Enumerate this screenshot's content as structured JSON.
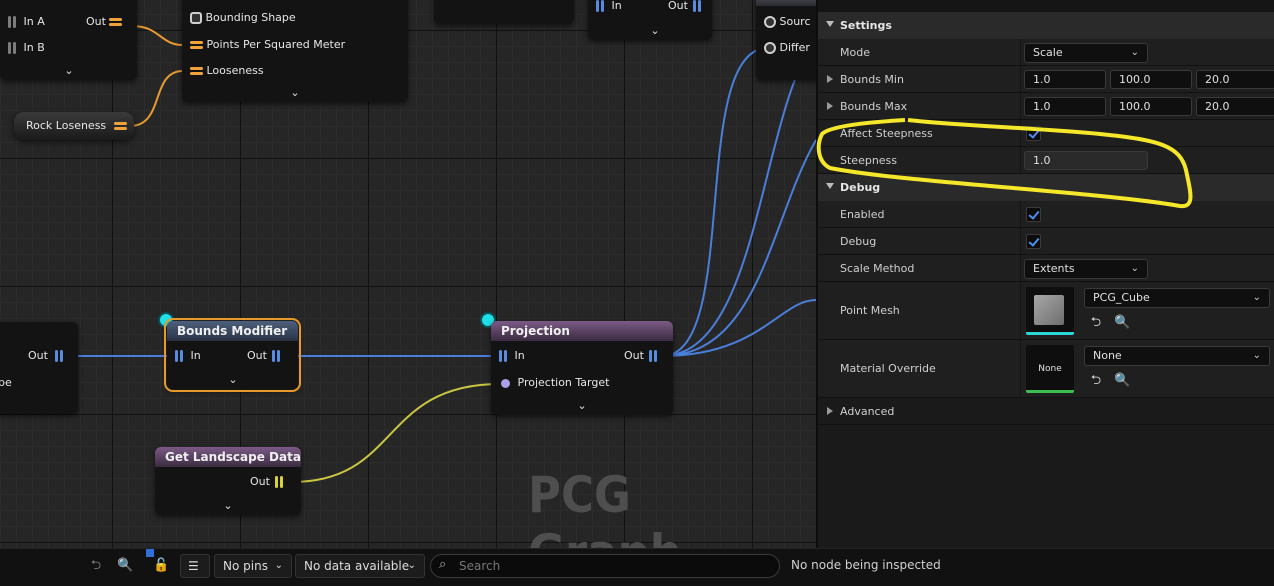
{
  "graph": {
    "watermark": "PCG Graph",
    "top_partial_node": {
      "in_a": "In A",
      "in_b": "In B",
      "out": "Out"
    },
    "surface_sampler_partial": {
      "bounding_shape": "Bounding Shape",
      "points_per_sq_meter": "Points Per Squared Meter",
      "looseness": "Looseness"
    },
    "top_mid_node": {
      "in": "In",
      "out": "Out"
    },
    "right_partial_node": {
      "source": "Sourc",
      "difference": "Differ"
    },
    "rock_looseness": {
      "label": "Rock Loseness"
    },
    "left_partial_node": {
      "out": "Out",
      "label_fragment": "be"
    },
    "bounds_modifier": {
      "title": "Bounds Modifier",
      "in": "In",
      "out": "Out"
    },
    "projection": {
      "title": "Projection",
      "in": "In",
      "out": "Out",
      "target": "Projection Target"
    },
    "get_landscape_data": {
      "title": "Get Landscape Data",
      "out": "Out"
    }
  },
  "details": {
    "settings_section": "Settings",
    "mode": {
      "label": "Mode",
      "value": "Scale"
    },
    "bounds_min": {
      "label": "Bounds Min",
      "x": "1.0",
      "y": "100.0",
      "z": "20.0"
    },
    "bounds_max": {
      "label": "Bounds Max",
      "x": "1.0",
      "y": "100.0",
      "z": "20.0"
    },
    "affect_steepness": {
      "label": "Affect Steepness",
      "checked": true
    },
    "steepness": {
      "label": "Steepness",
      "value": "1.0"
    },
    "debug_section": "Debug",
    "enabled": {
      "label": "Enabled",
      "checked": true
    },
    "debug": {
      "label": "Debug",
      "checked": true
    },
    "scale_method": {
      "label": "Scale Method",
      "value": "Extents"
    },
    "point_mesh": {
      "label": "Point Mesh",
      "value": "PCG_Cube"
    },
    "material_override": {
      "label": "Material Override",
      "value": "None",
      "thumb_text": "None"
    },
    "advanced_section": "Advanced"
  },
  "bottom": {
    "pins_filter": "No pins",
    "data_filter": "No data available",
    "search_placeholder": "Search",
    "inspect_status": "No node being inspected"
  },
  "colors": {
    "accent_blue": "#4b8ff0",
    "highlight": "#f5e72a",
    "selected": "#e79a2b",
    "cyan": "#1de0e8"
  }
}
